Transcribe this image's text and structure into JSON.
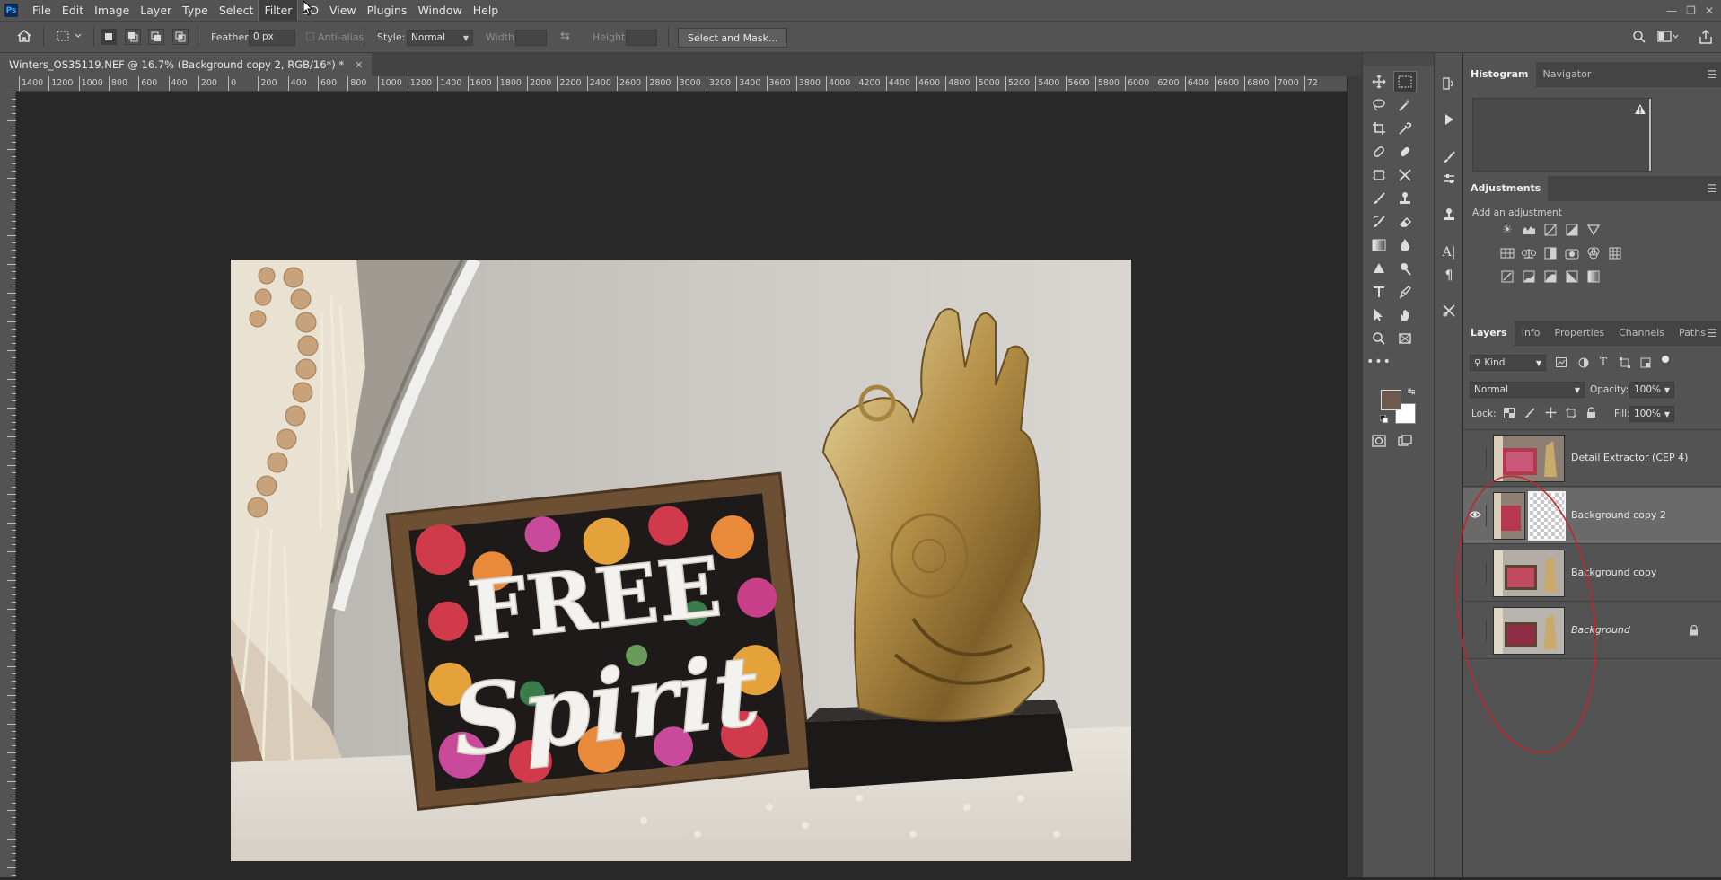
{
  "menubar": {
    "logo": "Ps",
    "items": [
      "File",
      "Edit",
      "Image",
      "Layer",
      "Type",
      "Select",
      "Filter",
      "3D",
      "View",
      "Plugins",
      "Window",
      "Help"
    ]
  },
  "options": {
    "feather_label": "Feather:",
    "feather_value": "0 px",
    "antialias_label": "Anti-alias",
    "style_label": "Style:",
    "style_value": "Normal",
    "width_label": "Width:",
    "height_label": "Height:",
    "select_mask_label": "Select and Mask..."
  },
  "document": {
    "tab_title": "Winters_OS35119.NEF @ 16.7% (Background copy 2, RGB/16*) *"
  },
  "ruler": {
    "h_labels": [
      "1400",
      "1200",
      "1000",
      "800",
      "600",
      "400",
      "200",
      "0",
      "200",
      "400",
      "600",
      "800",
      "1000",
      "1200",
      "1400",
      "1600",
      "1800",
      "2000",
      "2200",
      "2400",
      "2600",
      "2800",
      "3000",
      "3200",
      "3400",
      "3600",
      "3800",
      "4000",
      "4200",
      "4400",
      "4600",
      "4800",
      "5000",
      "5200",
      "5400",
      "5600",
      "5800",
      "6000",
      "6200",
      "6400",
      "6600",
      "6800",
      "7000",
      "72"
    ]
  },
  "colors": {
    "foreground": "#6e5a4e",
    "background": "#ffffff",
    "annotation_circle": "#c0262c"
  },
  "histogram_panel": {
    "tabs": [
      "Histogram",
      "Navigator"
    ],
    "warning_icon": "warning-icon"
  },
  "adjustments_panel": {
    "title": "Adjustments",
    "subtitle": "Add an adjustment"
  },
  "layers_panel": {
    "tabs": [
      "Layers",
      "Info",
      "Properties",
      "Channels",
      "Paths"
    ],
    "filter_kind": "Kind",
    "blend_mode": "Normal",
    "opacity_label": "Opacity:",
    "opacity_value": "100%",
    "lock_label": "Lock:",
    "fill_label": "Fill:",
    "fill_value": "100%",
    "layers": [
      {
        "name": "Detail Extractor  (CEP 4)",
        "visible": false,
        "selected": false,
        "locked": false,
        "mask": false
      },
      {
        "name": "Background copy 2",
        "visible": true,
        "selected": true,
        "locked": false,
        "mask": true
      },
      {
        "name": "Background copy",
        "visible": false,
        "selected": false,
        "locked": false,
        "mask": false
      },
      {
        "name": "Background",
        "visible": false,
        "selected": false,
        "locked": true,
        "mask": false
      }
    ]
  },
  "photo": {
    "sign_word_1": "FREE",
    "sign_word_2": "Spirit"
  }
}
